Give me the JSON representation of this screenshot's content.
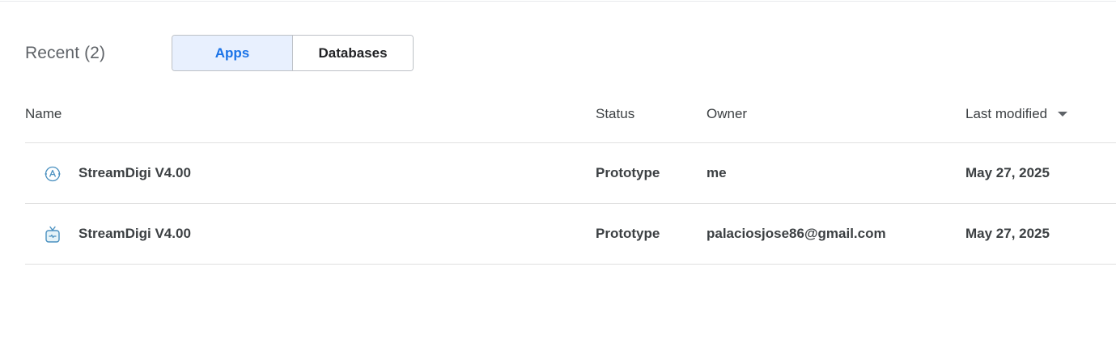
{
  "header": {
    "title": "Recent (2)",
    "tabs": [
      {
        "label": "Apps",
        "selected": true
      },
      {
        "label": "Databases",
        "selected": false
      }
    ]
  },
  "table": {
    "columns": {
      "name": "Name",
      "status": "Status",
      "owner": "Owner",
      "last_modified": "Last modified"
    },
    "sort": {
      "column": "last_modified",
      "direction": "descending"
    },
    "rows": [
      {
        "icon": "appsheet-logo-icon",
        "name": "StreamDigi V4.00",
        "status": "Prototype",
        "owner": "me",
        "last_modified": "May 27, 2025"
      },
      {
        "icon": "tv-icon",
        "name": "StreamDigi V4.00",
        "status": "Prototype",
        "owner": "palaciosjose86@gmail.com",
        "last_modified": "May 27, 2025"
      }
    ]
  },
  "colors": {
    "accent": "#1a73e8",
    "selected_tab_bg": "#e8f0fe",
    "icon_color": "#4a90c0",
    "divider": "#e0e0e0"
  }
}
